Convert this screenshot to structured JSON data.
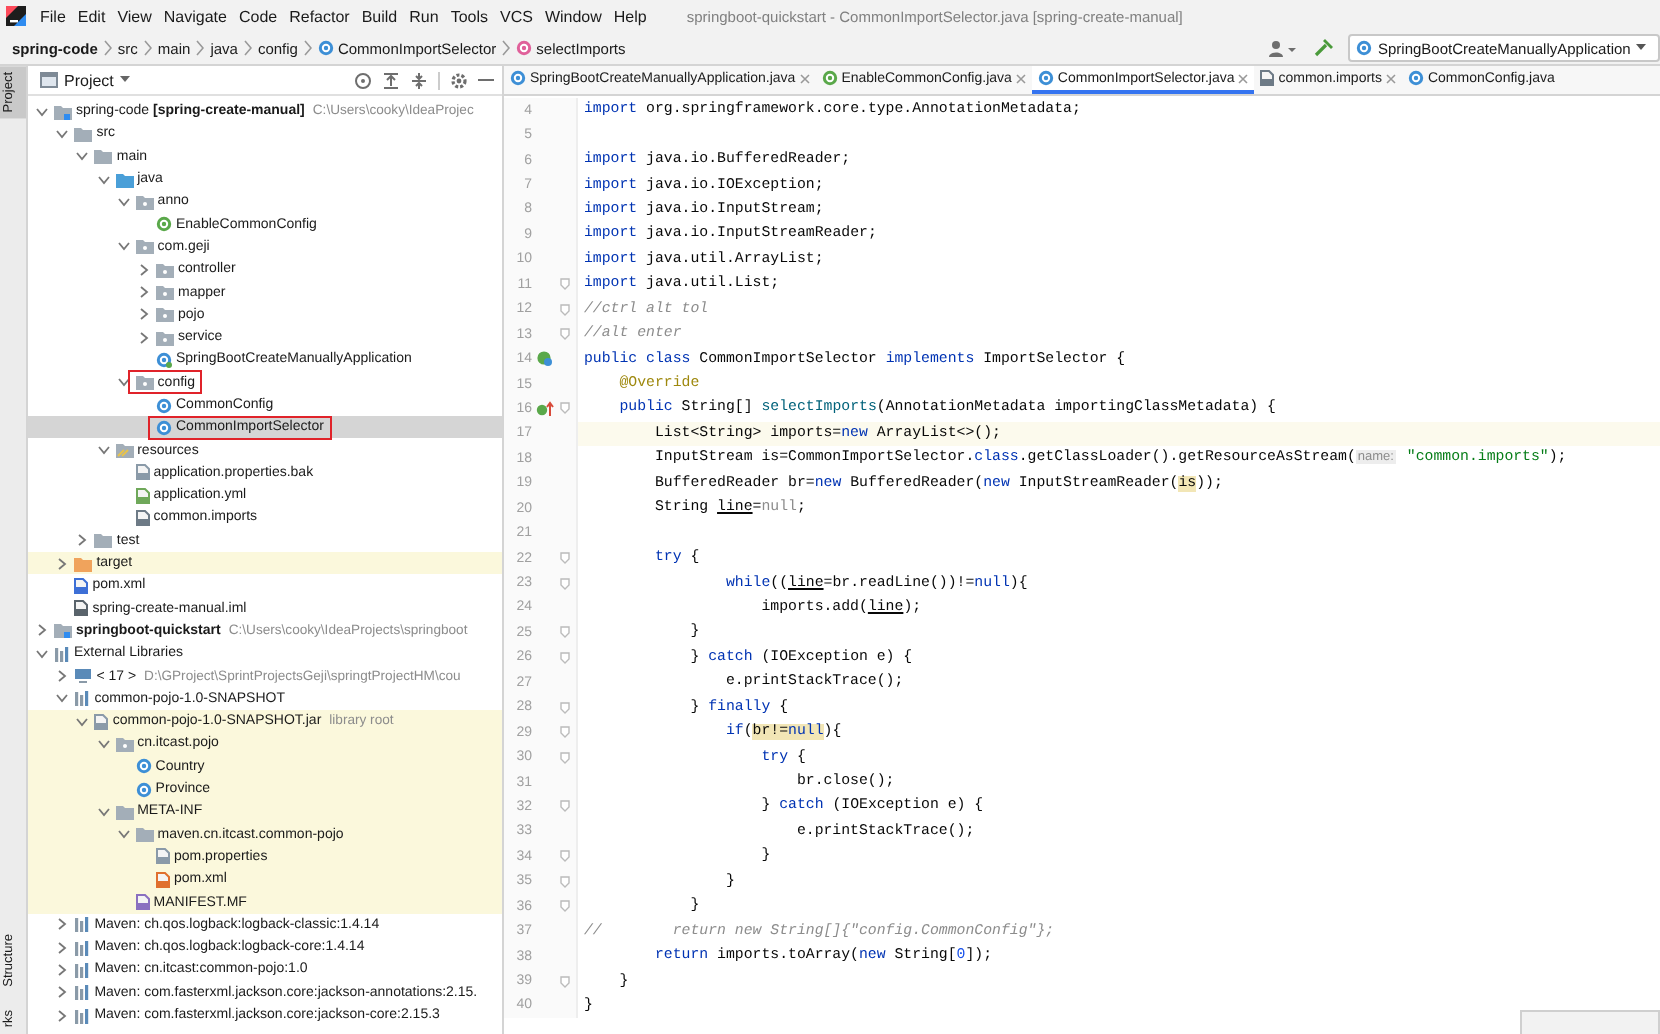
{
  "menu_bar": {
    "items": [
      "File",
      "Edit",
      "View",
      "Navigate",
      "Code",
      "Refactor",
      "Build",
      "Run",
      "Tools",
      "VCS",
      "Window",
      "Help"
    ],
    "title": "springboot-quickstart - CommonImportSelector.java [spring-create-manual]"
  },
  "breadcrumbs": [
    {
      "label": "spring-code",
      "kind": "project"
    },
    {
      "label": "src",
      "kind": "folder"
    },
    {
      "label": "main",
      "kind": "folder"
    },
    {
      "label": "java",
      "kind": "folder"
    },
    {
      "label": "config",
      "kind": "folder"
    },
    {
      "label": "CommonImportSelector",
      "kind": "class"
    },
    {
      "label": "selectImports",
      "kind": "method"
    }
  ],
  "toolbar": {
    "run_configuration": "SpringBootCreateManuallyApplication"
  },
  "tool_strip": [
    {
      "label": "Project",
      "kind": "top",
      "selected": true
    },
    {
      "label": "Structure",
      "kind": "bottom",
      "selected": false
    },
    {
      "label": "rks",
      "kind": "bottom",
      "selected": false
    }
  ],
  "project_panel": {
    "title": "Project",
    "tree": [
      {
        "label": "spring-code **[spring-create-manual]**",
        "path": "C:\\Users\\cooky\\IdeaProjec",
        "kind": "module",
        "bold": false,
        "expanded": true,
        "selected": false,
        "tinted": false,
        "outlined": false,
        "children": [
          {
            "label": "src",
            "kind": "folder",
            "expanded": true,
            "selected": false,
            "tinted": false,
            "outlined": false,
            "children": [
              {
                "label": "main",
                "kind": "folder",
                "expanded": true,
                "selected": false,
                "tinted": false,
                "outlined": false,
                "children": [
                  {
                    "label": "java",
                    "kind": "source-root",
                    "expanded": true,
                    "selected": false,
                    "tinted": false,
                    "outlined": false,
                    "children": [
                      {
                        "label": "anno",
                        "kind": "package",
                        "expanded": true,
                        "selected": false,
                        "tinted": false,
                        "outlined": false,
                        "children": [
                          {
                            "label": "EnableCommonConfig",
                            "kind": "annotation",
                            "selected": false,
                            "tinted": false,
                            "outlined": false
                          }
                        ]
                      },
                      {
                        "label": "com.geji",
                        "kind": "package",
                        "expanded": true,
                        "selected": false,
                        "tinted": false,
                        "outlined": false,
                        "children": [
                          {
                            "label": "controller",
                            "kind": "package",
                            "expanded": false,
                            "selected": false,
                            "tinted": false,
                            "outlined": false
                          },
                          {
                            "label": "mapper",
                            "kind": "package",
                            "expanded": false,
                            "selected": false,
                            "tinted": false,
                            "outlined": false
                          },
                          {
                            "label": "pojo",
                            "kind": "package",
                            "expanded": false,
                            "selected": false,
                            "tinted": false,
                            "outlined": false
                          },
                          {
                            "label": "service",
                            "kind": "package",
                            "expanded": false,
                            "selected": false,
                            "tinted": false,
                            "outlined": false
                          },
                          {
                            "label": "SpringBootCreateManuallyApplication",
                            "kind": "spring-class",
                            "selected": false,
                            "tinted": false,
                            "outlined": false
                          }
                        ]
                      },
                      {
                        "label": "config",
                        "kind": "package",
                        "expanded": true,
                        "selected": false,
                        "tinted": false,
                        "outlined": true,
                        "children": [
                          {
                            "label": "CommonConfig",
                            "kind": "class",
                            "selected": false,
                            "tinted": false,
                            "outlined": false
                          },
                          {
                            "label": "CommonImportSelector",
                            "kind": "class",
                            "selected": true,
                            "tinted": false,
                            "outlined": true
                          }
                        ]
                      }
                    ]
                  },
                  {
                    "label": "resources",
                    "kind": "resources-root",
                    "expanded": true,
                    "selected": false,
                    "tinted": false,
                    "outlined": false,
                    "children": [
                      {
                        "label": "application.properties.bak",
                        "kind": "properties-file",
                        "selected": false,
                        "tinted": false,
                        "outlined": false
                      },
                      {
                        "label": "application.yml",
                        "kind": "yml-file",
                        "selected": false,
                        "tinted": false,
                        "outlined": false
                      },
                      {
                        "label": "common.imports",
                        "kind": "text-file",
                        "selected": false,
                        "tinted": false,
                        "outlined": false
                      }
                    ]
                  }
                ]
              },
              {
                "label": "test",
                "kind": "folder",
                "expanded": false,
                "selected": false,
                "tinted": false,
                "outlined": false
              }
            ]
          },
          {
            "label": "target",
            "kind": "excluded-folder",
            "expanded": false,
            "selected": false,
            "tinted": true,
            "outlined": false
          },
          {
            "label": "pom.xml",
            "kind": "maven-file",
            "selected": false,
            "tinted": false,
            "outlined": false
          },
          {
            "label": "spring-create-manual.iml",
            "kind": "iml-file",
            "selected": false,
            "tinted": false,
            "outlined": false
          }
        ]
      },
      {
        "label": "springboot-quickstart",
        "path": "C:\\Users\\cooky\\IdeaProjects\\springboot",
        "kind": "module",
        "bold": true,
        "expanded": false,
        "selected": false,
        "tinted": false,
        "outlined": false
      },
      {
        "label": "External Libraries",
        "kind": "library",
        "bold": false,
        "expanded": true,
        "selected": false,
        "tinted": false,
        "outlined": false,
        "children": [
          {
            "label": "< 17 >",
            "path": "D:\\GProject\\SprintProjectsGeji\\springtProjectHM\\cou",
            "kind": "jdk",
            "expanded": false,
            "selected": false,
            "tinted": false,
            "outlined": false
          },
          {
            "label": "common-pojo-1.0-SNAPSHOT",
            "kind": "library",
            "expanded": true,
            "selected": false,
            "tinted": false,
            "outlined": false,
            "children": [
              {
                "label": "common-pojo-1.0-SNAPSHOT.jar",
                "path": "library root",
                "kind": "jar",
                "expanded": true,
                "selected": false,
                "tinted": true,
                "outlined": false,
                "children": [
                  {
                    "label": "cn.itcast.pojo",
                    "kind": "package",
                    "expanded": true,
                    "selected": false,
                    "tinted": true,
                    "outlined": false,
                    "children": [
                      {
                        "label": "Country",
                        "kind": "class",
                        "selected": false,
                        "tinted": true,
                        "outlined": false
                      },
                      {
                        "label": "Province",
                        "kind": "class",
                        "selected": false,
                        "tinted": true,
                        "outlined": false
                      }
                    ]
                  },
                  {
                    "label": "META-INF",
                    "kind": "folder",
                    "expanded": true,
                    "selected": false,
                    "tinted": true,
                    "outlined": false,
                    "children": [
                      {
                        "label": "maven.cn.itcast.common-pojo",
                        "kind": "folder",
                        "expanded": true,
                        "selected": false,
                        "tinted": true,
                        "outlined": false,
                        "children": [
                          {
                            "label": "pom.properties",
                            "kind": "properties-file",
                            "selected": false,
                            "tinted": true,
                            "outlined": false
                          },
                          {
                            "label": "pom.xml",
                            "kind": "xml-file",
                            "selected": false,
                            "tinted": true,
                            "outlined": false
                          }
                        ]
                      },
                      {
                        "label": "MANIFEST.MF",
                        "kind": "manifest-file",
                        "selected": false,
                        "tinted": true,
                        "outlined": false
                      }
                    ]
                  }
                ]
              }
            ]
          },
          {
            "label": "Maven: ch.qos.logback:logback-classic:1.4.14",
            "kind": "library",
            "expanded": false,
            "selected": false,
            "tinted": false,
            "outlined": false
          },
          {
            "label": "Maven: ch.qos.logback:logback-core:1.4.14",
            "kind": "library",
            "expanded": false,
            "selected": false,
            "tinted": false,
            "outlined": false
          },
          {
            "label": "Maven: cn.itcast:common-pojo:1.0",
            "kind": "library",
            "expanded": false,
            "selected": false,
            "tinted": false,
            "outlined": false
          },
          {
            "label": "Maven: com.fasterxml.jackson.core:jackson-annotations:2.15.",
            "kind": "library",
            "expanded": false,
            "selected": false,
            "tinted": false,
            "outlined": false
          },
          {
            "label": "Maven: com.fasterxml.jackson.core:jackson-core:2.15.3",
            "kind": "library",
            "expanded": false,
            "selected": false,
            "tinted": false,
            "outlined": false
          }
        ]
      }
    ]
  },
  "editor": {
    "tabs": [
      {
        "label": "SpringBootCreateManuallyApplication.java",
        "kind": "spring-class",
        "selected": false,
        "closable": true
      },
      {
        "label": "EnableCommonConfig.java",
        "kind": "annotation",
        "selected": false,
        "closable": true
      },
      {
        "label": "CommonImportSelector.java",
        "kind": "class",
        "selected": true,
        "closable": true
      },
      {
        "label": "common.imports",
        "kind": "text-file",
        "selected": false,
        "closable": true
      },
      {
        "label": "CommonConfig.java",
        "kind": "class",
        "selected": false,
        "closable": false
      }
    ],
    "lines": [
      {
        "number": "4",
        "current": false,
        "fold": false,
        "tokens": [
          {
            "text": "import",
            "kind": "kw"
          },
          {
            "text": " org.springframework.core.type.AnnotationMetadata;",
            "kind": "plain"
          }
        ]
      },
      {
        "number": "5",
        "current": false,
        "fold": false
      },
      {
        "number": "6",
        "current": false,
        "fold": false,
        "tokens": [
          {
            "text": "import",
            "kind": "kw"
          },
          {
            "text": " java.io.BufferedReader;",
            "kind": "plain"
          }
        ]
      },
      {
        "number": "7",
        "current": false,
        "fold": false,
        "tokens": [
          {
            "text": "import",
            "kind": "kw"
          },
          {
            "text": " java.io.IOException;",
            "kind": "plain"
          }
        ]
      },
      {
        "number": "8",
        "current": false,
        "fold": false,
        "tokens": [
          {
            "text": "import",
            "kind": "kw"
          },
          {
            "text": " java.io.InputStream;",
            "kind": "plain"
          }
        ]
      },
      {
        "number": "9",
        "current": false,
        "fold": false,
        "tokens": [
          {
            "text": "import",
            "kind": "kw"
          },
          {
            "text": " java.io.InputStreamReader;",
            "kind": "plain"
          }
        ]
      },
      {
        "number": "10",
        "current": false,
        "fold": false,
        "tokens": [
          {
            "text": "import",
            "kind": "kw"
          },
          {
            "text": " java.util.ArrayList;",
            "kind": "plain"
          }
        ]
      },
      {
        "number": "11",
        "current": false,
        "fold": true,
        "tokens": [
          {
            "text": "import",
            "kind": "kw"
          },
          {
            "text": " java.util.List;",
            "kind": "plain"
          }
        ]
      },
      {
        "number": "12",
        "current": false,
        "fold": true,
        "tokens": [
          {
            "text": "//ctrl alt tol",
            "kind": "comment"
          }
        ]
      },
      {
        "number": "13",
        "current": false,
        "fold": true,
        "tokens": [
          {
            "text": "//alt enter",
            "kind": "comment"
          }
        ]
      },
      {
        "number": "14",
        "current": false,
        "fold": false,
        "kind": "implemented",
        "tokens": [
          {
            "text": "public class",
            "kind": "kw"
          },
          {
            "text": " CommonImportSelector ",
            "kind": "plain"
          },
          {
            "text": "implements",
            "kind": "kw"
          },
          {
            "text": " ImportSelector {",
            "kind": "plain"
          }
        ]
      },
      {
        "number": "15",
        "current": false,
        "fold": false,
        "tokens": [
          {
            "text": "    @Override",
            "kind": "anno"
          }
        ]
      },
      {
        "number": "16",
        "current": false,
        "fold": true,
        "kind": "override",
        "tokens": [
          {
            "text": "    public",
            "kind": "kw"
          },
          {
            "text": " String[] ",
            "kind": "plain"
          },
          {
            "text": "selectImports",
            "kind": "method"
          },
          {
            "text": "(AnnotationMetadata importingClassMetadata) {",
            "kind": "plain"
          }
        ]
      },
      {
        "number": "17",
        "current": true,
        "fold": false,
        "tokens": [
          {
            "text": "        List<String> imports=",
            "kind": "plain"
          },
          {
            "text": "new",
            "kind": "kw"
          },
          {
            "text": " ArrayList<>();",
            "kind": "plain"
          }
        ]
      },
      {
        "number": "18",
        "current": false,
        "fold": false,
        "tokens": [
          {
            "text": "        InputStream is=CommonImportSelector.",
            "kind": "plain"
          },
          {
            "text": "class",
            "kind": "kw"
          },
          {
            "text": ".getClassLoader().getResourceAsStream(",
            "kind": "plain"
          },
          {
            "text": "name:",
            "kind": "hint"
          },
          {
            "text": " \"common.imports\"",
            "kind": "str"
          },
          {
            "text": ");",
            "kind": "plain"
          }
        ]
      },
      {
        "number": "19",
        "current": false,
        "fold": false,
        "tokens": [
          {
            "text": "        BufferedReader br=",
            "kind": "plain"
          },
          {
            "text": "new",
            "kind": "kw"
          },
          {
            "text": " BufferedReader(",
            "kind": "plain"
          },
          {
            "text": "new",
            "kind": "kw"
          },
          {
            "text": " InputStreamReader(",
            "kind": "plain"
          },
          {
            "text": "is",
            "kind": "mark"
          },
          {
            "text": "));",
            "kind": "plain"
          }
        ]
      },
      {
        "number": "20",
        "current": false,
        "fold": false,
        "tokens": [
          {
            "text": "        String ",
            "kind": "plain"
          },
          {
            "text": "line",
            "kind": "var"
          },
          {
            "text": "=",
            "kind": "plain"
          },
          {
            "text": "null",
            "kind": "dim"
          },
          {
            "text": ";",
            "kind": "plain"
          }
        ]
      },
      {
        "number": "21",
        "current": false,
        "fold": false
      },
      {
        "number": "22",
        "current": false,
        "fold": true,
        "tokens": [
          {
            "text": "        try",
            "kind": "kw"
          },
          {
            "text": " {",
            "kind": "plain"
          }
        ]
      },
      {
        "number": "23",
        "current": false,
        "fold": true,
        "tokens": [
          {
            "text": "                while",
            "kind": "kw"
          },
          {
            "text": "((",
            "kind": "plain"
          },
          {
            "text": "line",
            "kind": "var"
          },
          {
            "text": "=br.readLine())!=",
            "kind": "plain"
          },
          {
            "text": "null",
            "kind": "kw"
          },
          {
            "text": "){",
            "kind": "plain"
          }
        ]
      },
      {
        "number": "24",
        "current": false,
        "fold": false,
        "tokens": [
          {
            "text": "                    imports.add(",
            "kind": "plain"
          },
          {
            "text": "line",
            "kind": "var"
          },
          {
            "text": ");",
            "kind": "plain"
          }
        ]
      },
      {
        "number": "25",
        "current": false,
        "fold": true,
        "tokens": [
          {
            "text": "            }",
            "kind": "plain"
          }
        ]
      },
      {
        "number": "26",
        "current": false,
        "fold": true,
        "tokens": [
          {
            "text": "            } ",
            "kind": "plain"
          },
          {
            "text": "catch",
            "kind": "kw"
          },
          {
            "text": " (IOException e) {",
            "kind": "plain"
          }
        ]
      },
      {
        "number": "27",
        "current": false,
        "fold": false,
        "tokens": [
          {
            "text": "                e.printStackTrace();",
            "kind": "plain"
          }
        ]
      },
      {
        "number": "28",
        "current": false,
        "fold": true,
        "tokens": [
          {
            "text": "            } ",
            "kind": "plain"
          },
          {
            "text": "finally",
            "kind": "kw"
          },
          {
            "text": " {",
            "kind": "plain"
          }
        ]
      },
      {
        "number": "29",
        "current": false,
        "fold": true,
        "tokens": [
          {
            "text": "                if",
            "kind": "kw"
          },
          {
            "text": "(",
            "kind": "plain"
          },
          {
            "text": "br!=",
            "kind": "mark"
          },
          {
            "text": "null",
            "kind": "mark-kw"
          },
          {
            "text": "){",
            "kind": "plain"
          }
        ]
      },
      {
        "number": "30",
        "current": false,
        "fold": true,
        "tokens": [
          {
            "text": "                    try",
            "kind": "kw"
          },
          {
            "text": " {",
            "kind": "plain"
          }
        ]
      },
      {
        "number": "31",
        "current": false,
        "fold": false,
        "tokens": [
          {
            "text": "                        br.close();",
            "kind": "plain"
          }
        ]
      },
      {
        "number": "32",
        "current": false,
        "fold": true,
        "tokens": [
          {
            "text": "                    } ",
            "kind": "plain"
          },
          {
            "text": "catch",
            "kind": "kw"
          },
          {
            "text": " (IOException e) {",
            "kind": "plain"
          }
        ]
      },
      {
        "number": "33",
        "current": false,
        "fold": false,
        "tokens": [
          {
            "text": "                        e.printStackTrace();",
            "kind": "plain"
          }
        ]
      },
      {
        "number": "34",
        "current": false,
        "fold": true,
        "tokens": [
          {
            "text": "                    }",
            "kind": "plain"
          }
        ]
      },
      {
        "number": "35",
        "current": false,
        "fold": true,
        "tokens": [
          {
            "text": "                }",
            "kind": "plain"
          }
        ]
      },
      {
        "number": "36",
        "current": false,
        "fold": true,
        "tokens": [
          {
            "text": "            }",
            "kind": "plain"
          }
        ]
      },
      {
        "number": "37",
        "current": false,
        "fold": false,
        "tokens": [
          {
            "text": "//        return new String[]{\"config.CommonConfig\"};",
            "kind": "comment"
          }
        ]
      },
      {
        "number": "38",
        "current": false,
        "fold": false,
        "tokens": [
          {
            "text": "        return",
            "kind": "kw"
          },
          {
            "text": " imports.toArray(",
            "kind": "plain"
          },
          {
            "text": "new",
            "kind": "kw"
          },
          {
            "text": " String[",
            "kind": "plain"
          },
          {
            "text": "0",
            "kind": "num"
          },
          {
            "text": "]);",
            "kind": "plain"
          }
        ]
      },
      {
        "number": "39",
        "current": false,
        "fold": true,
        "tokens": [
          {
            "text": "    }",
            "kind": "plain"
          }
        ]
      },
      {
        "number": "40",
        "current": false,
        "fold": false,
        "tokens": [
          {
            "text": "}",
            "kind": "plain"
          }
        ]
      }
    ]
  }
}
